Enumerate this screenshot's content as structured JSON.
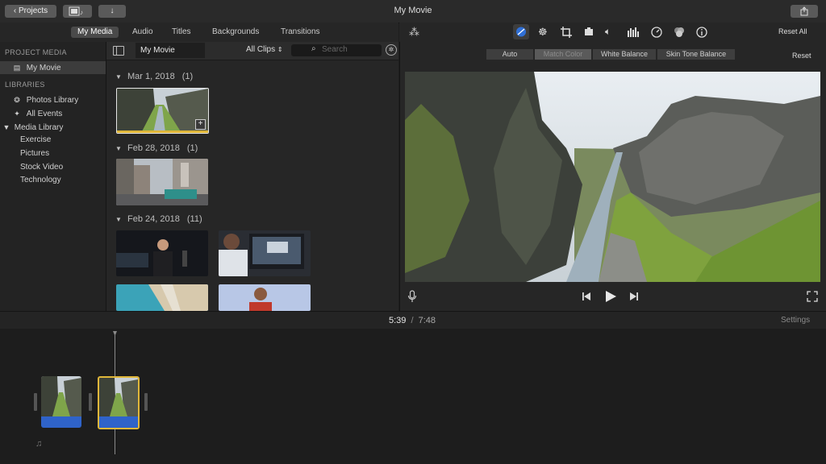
{
  "titlebar": {
    "projects_label": "Projects",
    "title": "My Movie"
  },
  "tabs": [
    "My Media",
    "Audio",
    "Titles",
    "Backgrounds",
    "Transitions"
  ],
  "sidebar": {
    "project_media_header": "PROJECT MEDIA",
    "project_item": "My Movie",
    "libraries_header": "LIBRARIES",
    "items": [
      "Photos Library",
      "All Events",
      "Media Library",
      "Exercise",
      "Pictures",
      "Stock Video",
      "Technology"
    ]
  },
  "browser": {
    "event_title": "My Movie",
    "filter": "All Clips",
    "search_placeholder": "Search",
    "groups": [
      {
        "date": "Mar 1, 2018",
        "count": "(1)"
      },
      {
        "date": "Feb 28, 2018",
        "count": "(1)"
      },
      {
        "date": "Feb 24, 2018",
        "count": "(11)"
      }
    ]
  },
  "viewer": {
    "reset_all": "Reset All",
    "reset": "Reset",
    "color_options": [
      "Auto",
      "Match Color",
      "White Balance",
      "Skin Tone Balance"
    ]
  },
  "timebar": {
    "current": "5:39",
    "separator": "/",
    "total": "7:48",
    "settings": "Settings"
  },
  "colors": {
    "accent": "#e0b73a",
    "audio_blue": "#2f63c9",
    "active_tool": "#2f6fd6"
  }
}
